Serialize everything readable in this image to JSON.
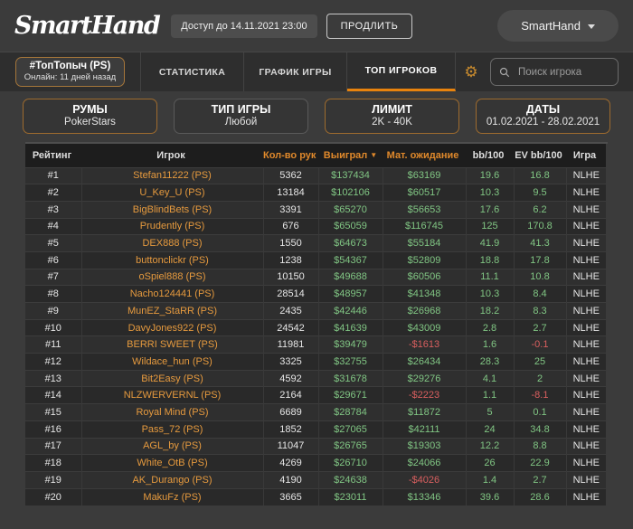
{
  "header": {
    "logo": "SmartHand",
    "access_badge": "Доступ до 14.11.2021 23:00",
    "extend_button": "ПРОДЛИТЬ",
    "account_menu": "SmartHand"
  },
  "nav": {
    "club": {
      "title": "#ТопТопыч (PS)",
      "subtitle": "Онлайн: 11 дней назад"
    },
    "tabs": [
      {
        "label": "СТАТИСТИКА",
        "active": false
      },
      {
        "label": "ГРАФИК ИГРЫ",
        "active": false
      },
      {
        "label": "ТОП ИГРОКОВ",
        "active": true
      }
    ],
    "gear_icon": "⚙",
    "search_placeholder": "Поиск игрока"
  },
  "filters": [
    {
      "key": "rooms",
      "label": "РУМЫ",
      "value": "PokerStars",
      "highlighted": true
    },
    {
      "key": "game-type",
      "label": "ТИП ИГРЫ",
      "value": "Любой",
      "highlighted": false
    },
    {
      "key": "limit",
      "label": "ЛИМИТ",
      "value": "2K - 40K",
      "highlighted": true
    },
    {
      "key": "dates",
      "label": "ДАТЫ",
      "value": "01.02.2021 - 28.02.2021",
      "highlighted": true
    }
  ],
  "table": {
    "sort_desc_icon": "▼",
    "columns": [
      {
        "label": "Рейтинг",
        "accent": false
      },
      {
        "label": "Игрок",
        "accent": false
      },
      {
        "label": "Кол-во рук",
        "accent": true
      },
      {
        "label": "Выиграл",
        "accent": true,
        "sorted": "desc"
      },
      {
        "label": "Мат. ожидание",
        "accent": true
      },
      {
        "label": "bb/100",
        "accent": false
      },
      {
        "label": "EV bb/100",
        "accent": false
      },
      {
        "label": "Игра",
        "accent": false
      }
    ],
    "rows": [
      {
        "rank": "#1",
        "player": "Stefan11222 (PS)",
        "hands": "5362",
        "won": "$137434",
        "ev_money": "$63169",
        "bb100": "19.6",
        "ev_bb100": "16.8",
        "game": "NLHE"
      },
      {
        "rank": "#2",
        "player": "U_Key_U (PS)",
        "hands": "13184",
        "won": "$102106",
        "ev_money": "$60517",
        "bb100": "10.3",
        "ev_bb100": "9.5",
        "game": "NLHE"
      },
      {
        "rank": "#3",
        "player": "BigBlindBets (PS)",
        "hands": "3391",
        "won": "$65270",
        "ev_money": "$56653",
        "bb100": "17.6",
        "ev_bb100": "6.2",
        "game": "NLHE"
      },
      {
        "rank": "#4",
        "player": "Prudently (PS)",
        "hands": "676",
        "won": "$65059",
        "ev_money": "$116745",
        "bb100": "125",
        "ev_bb100": "170.8",
        "game": "NLHE"
      },
      {
        "rank": "#5",
        "player": "DEX888 (PS)",
        "hands": "1550",
        "won": "$64673",
        "ev_money": "$55184",
        "bb100": "41.9",
        "ev_bb100": "41.3",
        "game": "NLHE"
      },
      {
        "rank": "#6",
        "player": "buttonclickr (PS)",
        "hands": "1238",
        "won": "$54367",
        "ev_money": "$52809",
        "bb100": "18.8",
        "ev_bb100": "17.8",
        "game": "NLHE"
      },
      {
        "rank": "#7",
        "player": "oSpiel888 (PS)",
        "hands": "10150",
        "won": "$49688",
        "ev_money": "$60506",
        "bb100": "11.1",
        "ev_bb100": "10.8",
        "game": "NLHE"
      },
      {
        "rank": "#8",
        "player": "Nacho124441 (PS)",
        "hands": "28514",
        "won": "$48957",
        "ev_money": "$41348",
        "bb100": "10.3",
        "ev_bb100": "8.4",
        "game": "NLHE"
      },
      {
        "rank": "#9",
        "player": "MunEZ_StaRR (PS)",
        "hands": "2435",
        "won": "$42446",
        "ev_money": "$26968",
        "bb100": "18.2",
        "ev_bb100": "8.3",
        "game": "NLHE"
      },
      {
        "rank": "#10",
        "player": "DavyJones922 (PS)",
        "hands": "24542",
        "won": "$41639",
        "ev_money": "$43009",
        "bb100": "2.8",
        "ev_bb100": "2.7",
        "game": "NLHE"
      },
      {
        "rank": "#11",
        "player": "BERRI SWEET (PS)",
        "hands": "11981",
        "won": "$39479",
        "ev_money": "-$1613",
        "bb100": "1.6",
        "ev_bb100": "-0.1",
        "game": "NLHE"
      },
      {
        "rank": "#12",
        "player": "Wildace_hun (PS)",
        "hands": "3325",
        "won": "$32755",
        "ev_money": "$26434",
        "bb100": "28.3",
        "ev_bb100": "25",
        "game": "NLHE"
      },
      {
        "rank": "#13",
        "player": "Bit2Easy (PS)",
        "hands": "4592",
        "won": "$31678",
        "ev_money": "$29276",
        "bb100": "4.1",
        "ev_bb100": "2",
        "game": "NLHE"
      },
      {
        "rank": "#14",
        "player": "NLZWERVERNL (PS)",
        "hands": "2164",
        "won": "$29671",
        "ev_money": "-$2223",
        "bb100": "1.1",
        "ev_bb100": "-8.1",
        "game": "NLHE"
      },
      {
        "rank": "#15",
        "player": "Royal Mind (PS)",
        "hands": "6689",
        "won": "$28784",
        "ev_money": "$11872",
        "bb100": "5",
        "ev_bb100": "0.1",
        "game": "NLHE"
      },
      {
        "rank": "#16",
        "player": "Pass_72 (PS)",
        "hands": "1852",
        "won": "$27065",
        "ev_money": "$42111",
        "bb100": "24",
        "ev_bb100": "34.8",
        "game": "NLHE"
      },
      {
        "rank": "#17",
        "player": "AGL_by (PS)",
        "hands": "11047",
        "won": "$26765",
        "ev_money": "$19303",
        "bb100": "12.2",
        "ev_bb100": "8.8",
        "game": "NLHE"
      },
      {
        "rank": "#18",
        "player": "White_OtB (PS)",
        "hands": "4269",
        "won": "$26710",
        "ev_money": "$24066",
        "bb100": "26",
        "ev_bb100": "22.9",
        "game": "NLHE"
      },
      {
        "rank": "#19",
        "player": "AK_Durango (PS)",
        "hands": "4190",
        "won": "$24638",
        "ev_money": "-$4026",
        "bb100": "1.4",
        "ev_bb100": "2.7",
        "game": "NLHE"
      },
      {
        "rank": "#20",
        "player": "MakuFz (PS)",
        "hands": "3665",
        "won": "$23011",
        "ev_money": "$13346",
        "bb100": "39.6",
        "ev_bb100": "28.6",
        "game": "NLHE"
      }
    ]
  },
  "colors": {
    "accent_orange": "#e0892b",
    "positive_green": "#80c583",
    "negative_red": "#d95f5f",
    "active_tab_underline": "#e8830d",
    "gear_orange": "#c78a2e"
  }
}
